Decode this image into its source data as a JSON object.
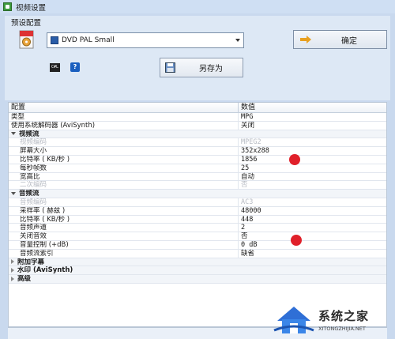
{
  "window": {
    "title": "视频设置"
  },
  "preset": {
    "label": "预设配置",
    "selected": "DVD PAL Small",
    "ok_label": "确定",
    "saveas_label": "另存为",
    "small_icon_text": "C#L",
    "help_icon_text": "?"
  },
  "grid": {
    "header": {
      "name": "配置",
      "value": "数值"
    },
    "rows": [
      {
        "name": "类型",
        "value": "MPG",
        "kind": "top"
      },
      {
        "name": "使用系统解码器 (AviSynth)",
        "value": "关闭",
        "kind": "top"
      },
      {
        "name": "视频流",
        "value": "",
        "kind": "group-open"
      },
      {
        "name": "视频编码",
        "value": "MPEG2",
        "kind": "disabled"
      },
      {
        "name": "屏幕大小",
        "value": "352x288",
        "kind": "item"
      },
      {
        "name": "比特率 ( KB/秒 )",
        "value": "1856",
        "kind": "item"
      },
      {
        "name": "每秒帧数",
        "value": "25",
        "kind": "item"
      },
      {
        "name": "宽高比",
        "value": "自动",
        "kind": "item"
      },
      {
        "name": "二次编码",
        "value": "否",
        "kind": "disabled"
      },
      {
        "name": "音频流",
        "value": "",
        "kind": "group-open"
      },
      {
        "name": "音频编码",
        "value": "AC3",
        "kind": "disabled"
      },
      {
        "name": "采样率 ( 赫兹 )",
        "value": "48000",
        "kind": "item"
      },
      {
        "name": "比特率 ( KB/秒 )",
        "value": "448",
        "kind": "item"
      },
      {
        "name": "音频声道",
        "value": "2",
        "kind": "item"
      },
      {
        "name": "关闭音效",
        "value": "否",
        "kind": "item"
      },
      {
        "name": "音量控制 (+dB)",
        "value": "0 dB",
        "kind": "item"
      },
      {
        "name": "音频流索引",
        "value": "缺省",
        "kind": "item"
      },
      {
        "name": "附加字幕",
        "value": "",
        "kind": "group-closed"
      },
      {
        "name": "水印 (AviSynth)",
        "value": "",
        "kind": "group-closed"
      },
      {
        "name": "高级",
        "value": "",
        "kind": "group-closed"
      }
    ]
  },
  "watermark": {
    "cn": "系统之家",
    "en": "XITONGZHIJIA.NET"
  },
  "colors": {
    "marker": "#e0202a",
    "accent": "#2a5da8"
  }
}
